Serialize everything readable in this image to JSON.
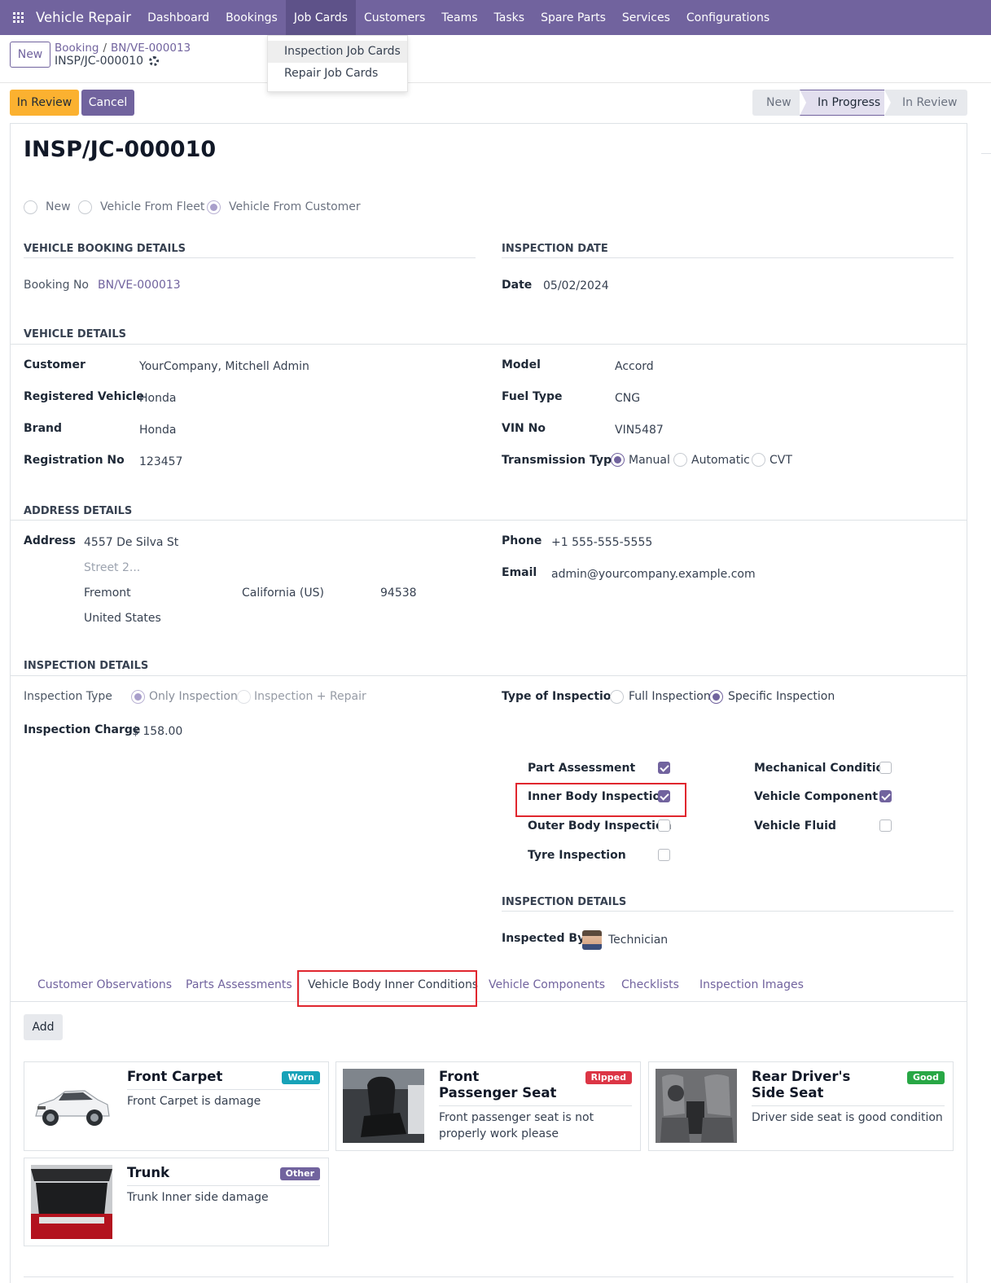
{
  "nav": {
    "app_name": "Vehicle Repair",
    "menu": [
      "Dashboard",
      "Bookings",
      "Job Cards",
      "Customers",
      "Teams",
      "Tasks",
      "Spare Parts",
      "Services",
      "Configurations"
    ],
    "dropdown": [
      "Inspection Job Cards",
      "Repair Job Cards"
    ]
  },
  "control": {
    "new_label": "New",
    "breadcrumb": [
      "Booking",
      "BN/VE-000013"
    ],
    "record": "INSP/JC-000010"
  },
  "actions": {
    "in_review": "In Review",
    "cancel": "Cancel"
  },
  "status": {
    "stages": [
      "New",
      "In Progress",
      "In Review"
    ],
    "current": "In Progress"
  },
  "form": {
    "title": "INSP/JC-000010",
    "vehicle_source": [
      "New",
      "Vehicle From Fleet",
      "Vehicle From Customer"
    ],
    "booking_section": "Vehicle Booking Details",
    "booking_no_label": "Booking No",
    "booking_no": "BN/VE-000013",
    "inspection_date_section": "Inspection Date",
    "date_label": "Date",
    "date": "05/02/2024",
    "vehicle_section": "Vehicle Details",
    "customer_label": "Customer",
    "customer": "YourCompany, Mitchell Admin",
    "registered_vehicle_label": "Registered Vehicle",
    "registered_vehicle": "Honda",
    "brand_label": "Brand",
    "brand": "Honda",
    "registration_label": "Registration No",
    "registration": "123457",
    "model_label": "Model",
    "model": "Accord",
    "fuel_label": "Fuel Type",
    "fuel": "CNG",
    "vin_label": "VIN No",
    "vin": "VIN5487",
    "transmission_label": "Transmission Type",
    "transmission_options": [
      "Manual",
      "Automatic",
      "CVT"
    ],
    "address_section": "Address Details",
    "address_label": "Address",
    "street": "4557 De Silva St",
    "street2_placeholder": "Street 2...",
    "city": "Fremont",
    "state": "California (US)",
    "zip": "94538",
    "country": "United States",
    "phone_label": "Phone",
    "phone": "+1 555-555-5555",
    "email_label": "Email",
    "email": "admin@yourcompany.example.com",
    "inspection_section": "Inspection Details",
    "inspection_type_label": "Inspection Type",
    "inspection_type_options": [
      "Only Inspection",
      "Inspection + Repair"
    ],
    "inspection_charge_label": "Inspection Charge",
    "inspection_charge": "$ 158.00",
    "type_of_inspection_label": "Type of Inspection",
    "type_of_inspection_options": [
      "Full Inspection",
      "Specific Inspection"
    ],
    "checks_left": [
      {
        "label": "Part Assessment",
        "checked": true
      },
      {
        "label": "Inner Body Inspection",
        "checked": true
      },
      {
        "label": "Outer Body Inspection",
        "checked": false
      },
      {
        "label": "Tyre Inspection",
        "checked": false
      }
    ],
    "checks_right": [
      {
        "label": "Mechanical Condition",
        "checked": false
      },
      {
        "label": "Vehicle Component",
        "checked": true
      },
      {
        "label": "Vehicle Fluid",
        "checked": false
      }
    ],
    "inspection_details_sub": "Inspection Details",
    "inspected_by_label": "Inspected By",
    "inspected_by": "Technician"
  },
  "tabs": [
    "Customer Observations",
    "Parts Assessments",
    "Vehicle Body Inner Conditions",
    "Vehicle Components",
    "Checklists",
    "Inspection Images"
  ],
  "add_label": "Add",
  "cards": [
    {
      "title": "Front Carpet",
      "badge": "Worn",
      "badge_color": "#17a2b8",
      "desc": "Front Carpet is damage"
    },
    {
      "title": "Front Passenger Seat",
      "badge": "Ripped",
      "badge_color": "#dc3545",
      "desc": "Front passenger seat is not properly work please"
    },
    {
      "title": "Rear Driver's Side Seat",
      "badge": "Good",
      "badge_color": "#28a745",
      "desc": "Driver side seat is good condition"
    },
    {
      "title": "Trunk",
      "badge": "Other",
      "badge_color": "#71639e",
      "desc": "Trunk Inner side damage"
    }
  ]
}
